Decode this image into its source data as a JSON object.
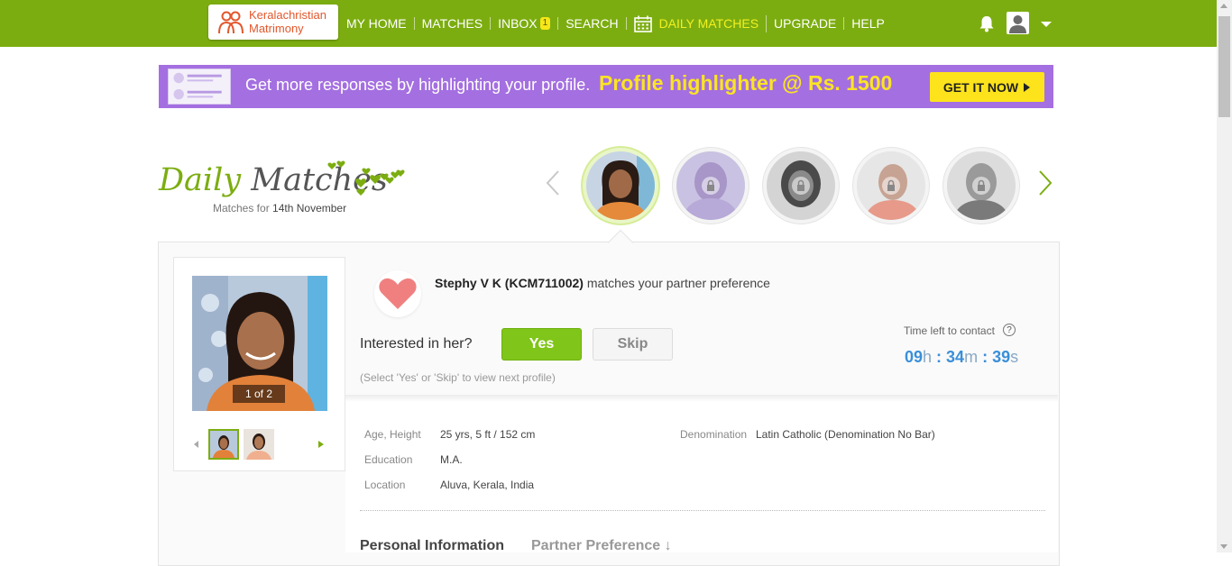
{
  "header": {
    "logo_line1": "Keralachristian",
    "logo_line2": "Matrimony",
    "nav": [
      {
        "label": "MY HOME"
      },
      {
        "label": "MATCHES"
      },
      {
        "label": "INBOX",
        "badge": "1"
      },
      {
        "label": "SEARCH"
      },
      {
        "label": "DAILY MATCHES"
      },
      {
        "label": "UPGRADE"
      },
      {
        "label": "HELP"
      }
    ]
  },
  "banner": {
    "text": "Get more responses by highlighting your profile.",
    "highlight": "Profile highlighter @ Rs. 1500",
    "cta": "GET IT NOW"
  },
  "daily": {
    "title_a": "Daily",
    "title_b": "Matches",
    "sub_prefix": "Matches for",
    "sub_date": "14th November"
  },
  "profile": {
    "photo_count": "1 of 2",
    "name": "Stephy V K (KCM711002)",
    "match_text": "matches your partner preference",
    "question": "Interested in her?",
    "yes": "Yes",
    "skip": "Skip",
    "hint": "(Select 'Yes' or 'Skip' to view next profile)",
    "timer_label": "Time left to contact",
    "timer": {
      "h": "09",
      "m": "34",
      "s": "39"
    },
    "details": {
      "age_label": "Age, Height",
      "age_value": "25 yrs, 5 ft / 152 cm",
      "edu_label": "Education",
      "edu_value": "M.A.",
      "loc_label": "Location",
      "loc_value": "Aluva, Kerala, India",
      "denom_label": "Denomination",
      "denom_value": "Latin Catholic (Denomination No Bar)"
    },
    "tabs": {
      "personal": "Personal Information",
      "partner": "Partner Preference ↓"
    }
  },
  "colors": {
    "brand_green": "#7cad10",
    "banner_purple": "#a46fe0",
    "timer_blue": "#3a8fd9"
  }
}
